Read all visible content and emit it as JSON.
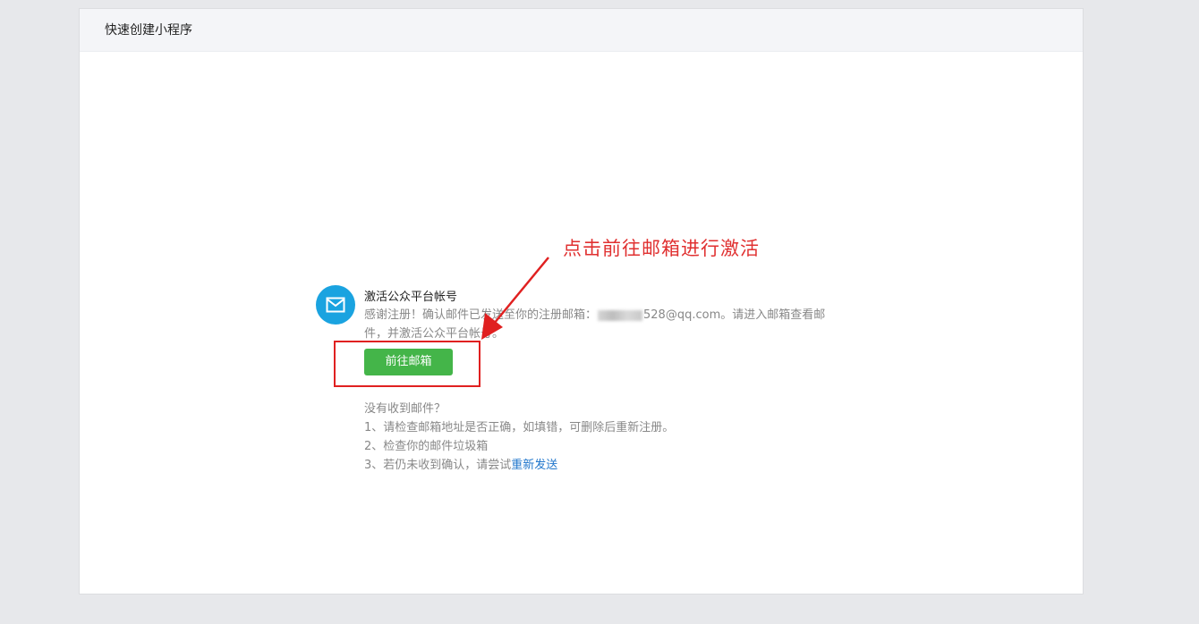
{
  "header": {
    "title": "快速创建小程序"
  },
  "activation": {
    "title": "激活公众平台帐号",
    "desc_prefix": "感谢注册！确认邮件已发送至你的注册邮箱：",
    "email_visible": "528@qq.com",
    "desc_suffix": "。请进入邮箱查看邮件，并激活公众平台帐号。",
    "button_label": "前往邮箱"
  },
  "annotation": {
    "text": "点击前往邮箱进行激活",
    "color": "#e03030"
  },
  "help": {
    "heading": "没有收到邮件？",
    "tip1": "1、请检查邮箱地址是否正确，如填错，可删除后重新注册。",
    "tip2": "2、检查你的邮件垃圾箱",
    "tip3_prefix": "3、若仍未收到确认，请尝试",
    "resend_label": "重新发送"
  },
  "colors": {
    "accent_green": "#44b549",
    "icon_blue": "#1aa3e0",
    "link_blue": "#2277cc",
    "annotation_red": "#e02020"
  },
  "icons": {
    "mail": "mail-icon"
  }
}
